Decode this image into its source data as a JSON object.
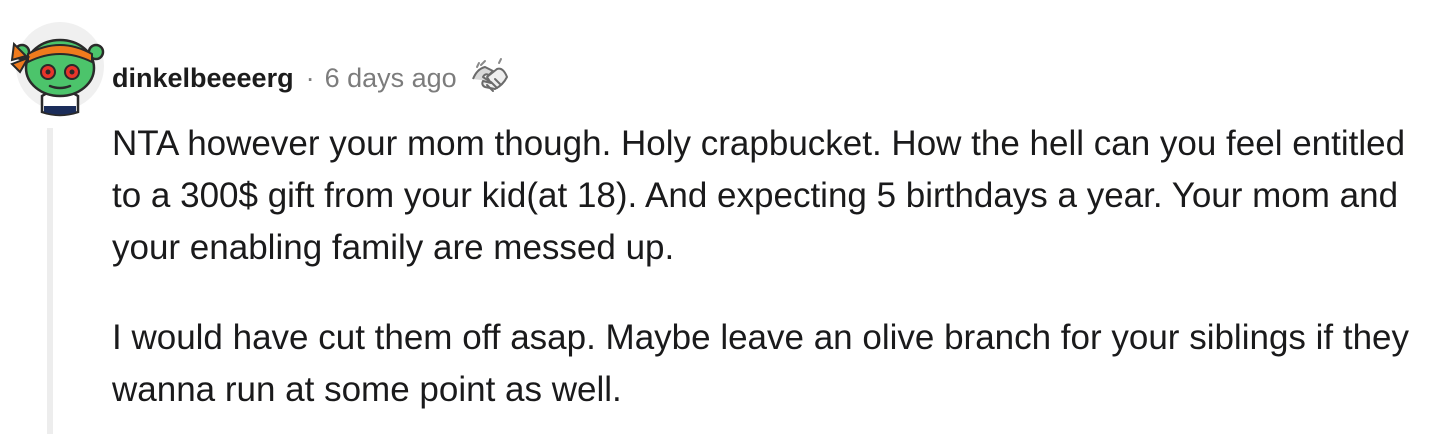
{
  "comment": {
    "username": "dinkelbeeeerg",
    "separator": "·",
    "timestamp": "6 days ago",
    "award_icon": "wholesome-handshake-icon",
    "avatar_icon": "snoo-avatar-icon",
    "paragraphs": [
      "NTA however your mom though. Holy crapbucket. How the hell can you feel entitled to a 300$ gift from your kid(at 18). And expecting 5 birthdays a year. Your mom and your enabling family are messed up.",
      "I would have cut them off asap. Maybe leave an olive branch for your siblings if they wanna run at some point as well."
    ]
  },
  "colors": {
    "username": "#1c1c1c",
    "meta": "#7c7c7c",
    "body_text": "#1a1a1b",
    "thread_line": "#ededed",
    "avatar_skin": "#4cc46b",
    "avatar_bandana": "#f07b1d"
  }
}
